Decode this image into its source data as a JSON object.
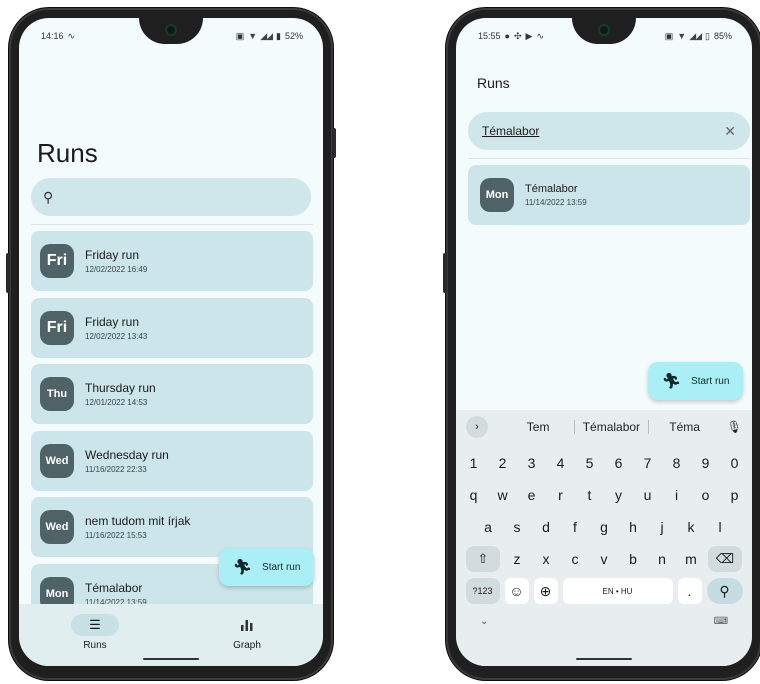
{
  "left_phone": {
    "status": {
      "time": "14:16",
      "battery": "52%"
    },
    "title": "Runs",
    "search": {
      "placeholder": ""
    },
    "runs": [
      {
        "badge": "Fri",
        "title": "Friday run",
        "date": "12/02/2022 16:49"
      },
      {
        "badge": "Fri",
        "title": "Friday run",
        "date": "12/02/2022 13:43"
      },
      {
        "badge": "Thu",
        "title": "Thursday run",
        "date": "12/01/2022 14:53"
      },
      {
        "badge": "Wed",
        "title": "Wednesday run",
        "date": "11/16/2022 22:33"
      },
      {
        "badge": "Wed",
        "title": "nem tudom mit írjak",
        "date": "11/16/2022 15:53"
      },
      {
        "badge": "Mon",
        "title": "Témalabor",
        "date": "11/14/2022 13:59"
      }
    ],
    "fab_label": "Start run",
    "nav": [
      {
        "label": "Runs",
        "icon": "list-icon",
        "active": true
      },
      {
        "label": "Graph",
        "icon": "bar-chart-icon",
        "active": false
      }
    ]
  },
  "right_phone": {
    "status": {
      "time": "15:55",
      "battery": "85%"
    },
    "title": "Runs",
    "search": {
      "value": "Témalabor"
    },
    "results": [
      {
        "badge": "Mon",
        "title": "Témalabor",
        "date": "11/14/2022 13:59"
      }
    ],
    "fab_label": "Start run",
    "keyboard": {
      "suggestions": [
        "Tem",
        "Témalabor",
        "Téma"
      ],
      "row1": [
        "1",
        "2",
        "3",
        "4",
        "5",
        "6",
        "7",
        "8",
        "9",
        "0"
      ],
      "row2": [
        "q",
        "w",
        "e",
        "r",
        "t",
        "y",
        "u",
        "i",
        "o",
        "p"
      ],
      "row3": [
        "a",
        "s",
        "d",
        "f",
        "g",
        "h",
        "j",
        "k",
        "l"
      ],
      "row4": [
        "z",
        "x",
        "c",
        "v",
        "b",
        "n",
        "m"
      ],
      "symbols_key": "?123",
      "space_label": "EN • HU",
      "period_key": "."
    }
  },
  "colors": {
    "card": "#cce5ea",
    "badge": "#4f6266",
    "fab": "#a9eff5",
    "search": "#cfe6ea"
  }
}
